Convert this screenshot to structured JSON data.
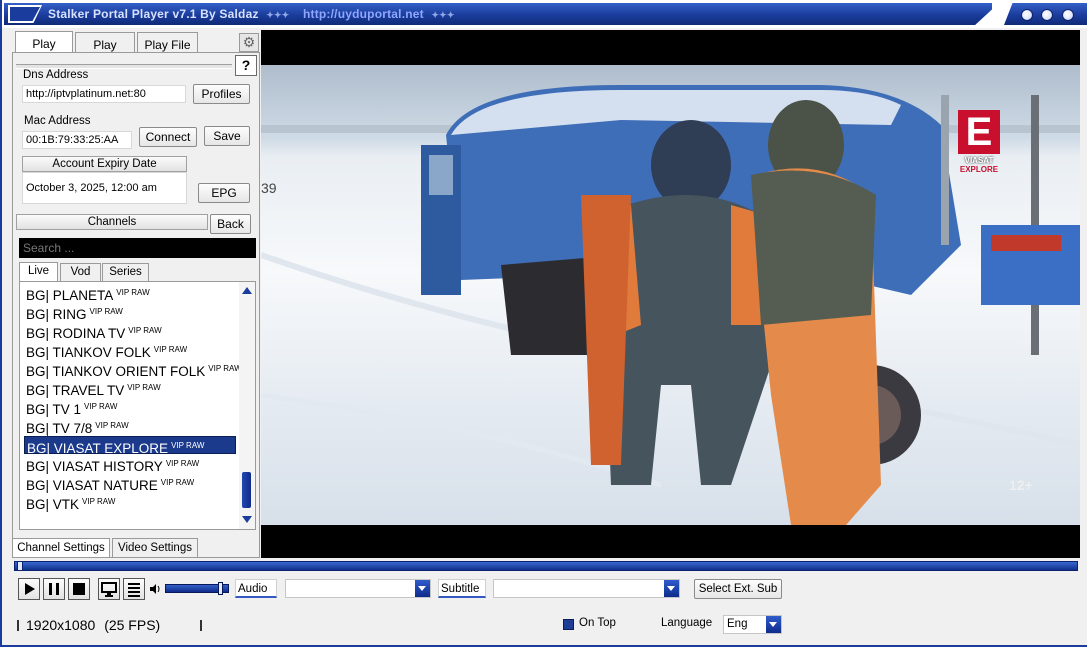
{
  "window": {
    "title": "Stalker Portal Player v7.1 By Saldaz",
    "title_url": "http://uyduportal.net"
  },
  "tabs": [
    "Play Mac",
    "Play URL",
    "Play File"
  ],
  "mac_panel": {
    "dns_label": "Dns Address",
    "dns_value": "http://iptvplatinum.net:80",
    "profiles_button": "Profiles",
    "mac_label": "Mac Address",
    "mac_value": "00:1B:79:33:25:AA",
    "connect_button": "Connect",
    "save_button": "Save",
    "expiry_label": "Account Expiry Date",
    "expiry_value": "October 3, 2025, 12:00 am",
    "epg_button": "EPG",
    "help_button": "?"
  },
  "channels": {
    "header": "Channels",
    "back_button": "Back",
    "search_placeholder": "Search ...",
    "subtabs": [
      "Live",
      "Vod",
      "Series"
    ],
    "items": [
      {
        "name": "BG| PLANETA",
        "tag": "VIP RAW"
      },
      {
        "name": "BG| RING",
        "tag": "VIP RAW"
      },
      {
        "name": "BG| RODINA TV",
        "tag": "VIP RAW"
      },
      {
        "name": "BG| TIANKOV FOLK",
        "tag": "VIP RAW"
      },
      {
        "name": "BG| TIANKOV ORIENT FOLK",
        "tag": "VIP RAW"
      },
      {
        "name": "BG| TRAVEL TV",
        "tag": "VIP RAW"
      },
      {
        "name": "BG| TV 1",
        "tag": "VIP RAW"
      },
      {
        "name": "BG| TV 7/8",
        "tag": "VIP RAW"
      },
      {
        "name": "BG| VIASAT EXPLORE",
        "tag": "VIP RAW"
      },
      {
        "name": "BG| VIASAT HISTORY",
        "tag": "VIP RAW"
      },
      {
        "name": "BG| VIASAT NATURE",
        "tag": "VIP RAW"
      },
      {
        "name": "BG| VTK",
        "tag": "VIP RAW"
      }
    ],
    "selected_index": 8
  },
  "bottom_tabs": [
    "Channel Settings",
    "Video Settings"
  ],
  "video": {
    "logo_letter": "E",
    "logo_line1": "VIASAT",
    "logo_line2": "EXPLORE",
    "age_rating": "12+",
    "scene_number": "39"
  },
  "controls": {
    "audio_label": "Audio",
    "subtitle_label": "Subtitle",
    "select_ext_sub_button": "Select Ext. Sub",
    "volume_level": 0.9,
    "seek_position": 0.0
  },
  "status": {
    "resolution": "1920x1080",
    "fps": "(25 FPS)",
    "on_top_label": "On Top",
    "on_top_checked": true,
    "language_label": "Language",
    "language_value": "Eng"
  },
  "colors": {
    "accent": "#1a3c9c",
    "selection": "#1b3a8c",
    "logo_red": "#c8102e"
  }
}
